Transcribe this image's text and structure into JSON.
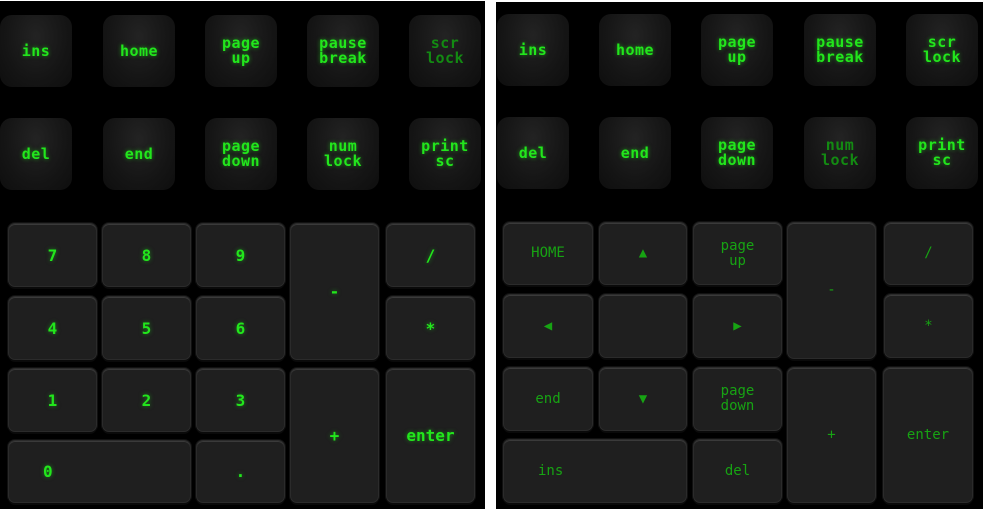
{
  "colors": {
    "bright_green": "#22e61c",
    "dim_green": "#138a12",
    "key_bg": "#1f1f1f",
    "panel_bg": "#000000"
  },
  "left": {
    "macro_keys": [
      {
        "label": "ins",
        "lit": true
      },
      {
        "label": "home",
        "lit": true
      },
      {
        "label": "page\nup",
        "lit": true
      },
      {
        "label": "pause\nbreak",
        "lit": true
      },
      {
        "label": "scr\nlock",
        "lit": false
      },
      {
        "label": "del",
        "lit": true
      },
      {
        "label": "end",
        "lit": true
      },
      {
        "label": "page\ndown",
        "lit": true
      },
      {
        "label": "num\nlock",
        "lit": true
      },
      {
        "label": "print\nsc",
        "lit": true
      }
    ],
    "numpad": {
      "k7": "7",
      "k8": "8",
      "k9": "9",
      "minus": "-",
      "divide": "/",
      "k4": "4",
      "k5": "5",
      "k6": "6",
      "multiply": "*",
      "k1": "1",
      "k2": "2",
      "k3": "3",
      "plus": "+",
      "enter": "enter",
      "k0": "0",
      "decimal": "."
    }
  },
  "right": {
    "macro_keys": [
      {
        "label": "ins",
        "lit": true
      },
      {
        "label": "home",
        "lit": true
      },
      {
        "label": "page\nup",
        "lit": true
      },
      {
        "label": "pause\nbreak",
        "lit": true
      },
      {
        "label": "scr\nlock",
        "lit": true
      },
      {
        "label": "del",
        "lit": true
      },
      {
        "label": "end",
        "lit": true
      },
      {
        "label": "page\ndown",
        "lit": true
      },
      {
        "label": "num\nlock",
        "lit": false
      },
      {
        "label": "print\nsc",
        "lit": true
      }
    ],
    "numpad": {
      "home": "HOME",
      "up": "▲",
      "pgup": "page\nup",
      "minus": "-",
      "divide": "/",
      "left": "◀",
      "center": "",
      "right": "▶",
      "multiply": "*",
      "end": "end",
      "down": "▼",
      "pgdn": "page\ndown",
      "plus": "+",
      "enter": "enter",
      "ins": "ins",
      "del": "del"
    }
  }
}
